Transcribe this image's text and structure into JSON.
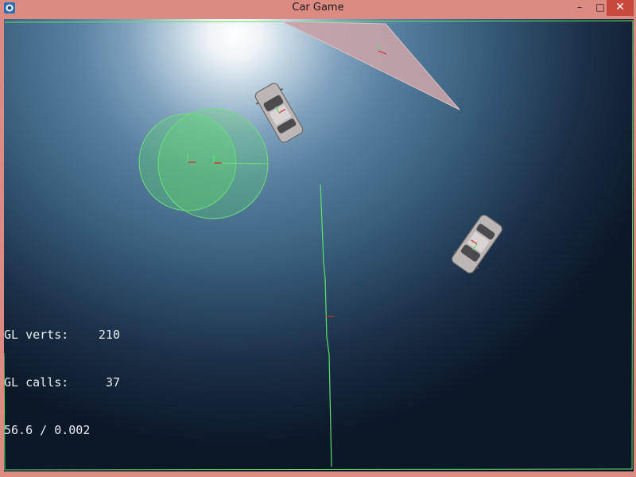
{
  "window": {
    "title": "Car Game",
    "app_icon": "app-icon",
    "controls": {
      "minimize": "–",
      "maximize": "□",
      "close": "✕"
    }
  },
  "colors": {
    "titlebar": "#dc8b83",
    "close_button": "#c7493d",
    "debug_green": "#5fe06a",
    "axis_red": "#e0242a",
    "ramp": "#c9a3a9"
  },
  "hud": {
    "verts_label": "GL verts:",
    "verts_value": "210",
    "calls_label": "GL calls:",
    "calls_value": "37",
    "fps_line": "56.6 / 0.002"
  },
  "scene": {
    "objects": [
      "ramp",
      "cylinder",
      "car",
      "car",
      "wall-line"
    ]
  }
}
